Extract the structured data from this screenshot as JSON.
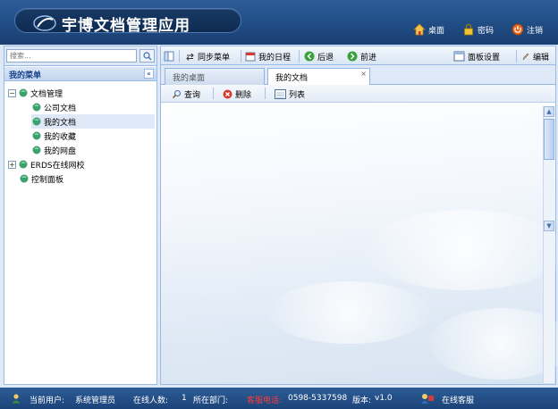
{
  "header": {
    "title": "宇博文档管理应用",
    "links": [
      {
        "label": "桌面",
        "icon": "home-icon"
      },
      {
        "label": "密码",
        "icon": "lock-icon"
      },
      {
        "label": "注销",
        "icon": "power-icon"
      }
    ]
  },
  "sidebar": {
    "search_placeholder": "搜索...",
    "menu_title": "我的菜单",
    "collapse_symbol": "«",
    "tree": [
      {
        "label": "文档管理",
        "expander": "−"
      },
      {
        "label": "公司文档"
      },
      {
        "label": "我的文档"
      },
      {
        "label": "我的收藏"
      },
      {
        "label": "我的网盘"
      },
      {
        "label": "ERDS在线网校",
        "expander": "+"
      },
      {
        "label": "控制面板"
      }
    ]
  },
  "toolbar": {
    "sync_menu": "同步菜单",
    "my_schedule": "我的日程",
    "back": "后退",
    "forward": "前进",
    "panel_settings": "面板设置",
    "edit": "编辑"
  },
  "tabs": [
    {
      "label": "我的桌面",
      "active": false
    },
    {
      "label": "我的文档",
      "active": true,
      "close": "×"
    }
  ],
  "content_toolbar": {
    "query": "查询",
    "delete": "删除",
    "list": "列表"
  },
  "statusbar": {
    "current_user_label": "当前用户:",
    "current_user": "系统管理员",
    "online_count_label": "在线人数:",
    "online_count": "1",
    "department_label": "所在部门:",
    "phone_red": "客服电话:",
    "phone": "0598-5337598",
    "version_label": "版本:",
    "version": "v1.0",
    "online_service": "在线客服"
  },
  "colors": {
    "header": "#2f5d98",
    "panel_border": "#99bbe8",
    "status_red": "#ff3b3b"
  }
}
